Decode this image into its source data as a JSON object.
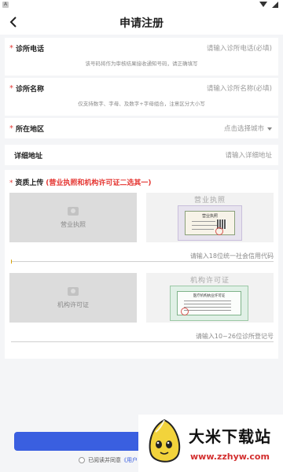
{
  "status_bar": {
    "app_icon_letter": "A"
  },
  "header": {
    "title": "申请注册"
  },
  "form": {
    "phone": {
      "required_mark": "*",
      "label": "诊所电话",
      "placeholder": "请输入诊所电话(必填)",
      "hint": "该号码将作为审核结果接收通知号码，请正确填写"
    },
    "name": {
      "required_mark": "*",
      "label": "诊所名称",
      "placeholder": "请输入诊所名称(必填)",
      "hint": "仅支持数字、字母、及数字+字母组合，注意区分大小写"
    },
    "region": {
      "required_mark": "*",
      "label": "所在地区",
      "placeholder": "点击选择城市"
    },
    "address": {
      "label": "详细地址",
      "placeholder": "请输入详细地址"
    }
  },
  "qualification": {
    "required_mark": "*",
    "label": "资质上传",
    "note": "(营业执照和机构许可证二选其一)",
    "business_license": {
      "upload_label": "营业执照",
      "sample_caption": "营业执照",
      "cert_title": "营业执照",
      "input_placeholder": "请输入18位统一社会信用代码"
    },
    "institution_license": {
      "upload_label": "机构许可证",
      "sample_caption": "机构许可证",
      "cert_title": "医疗机构执业许可证",
      "input_placeholder": "请输入10~26位诊所登记号"
    }
  },
  "footer": {
    "submit_label": "",
    "agree_text": "已阅读并同意",
    "agree_link": "《用户"
  },
  "watermark": {
    "brand": "大米下载站",
    "url": "www.zzhyw.com"
  },
  "colors": {
    "primary": "#3a5fe0",
    "required": "#e53935",
    "background": "#f4f5f7"
  }
}
